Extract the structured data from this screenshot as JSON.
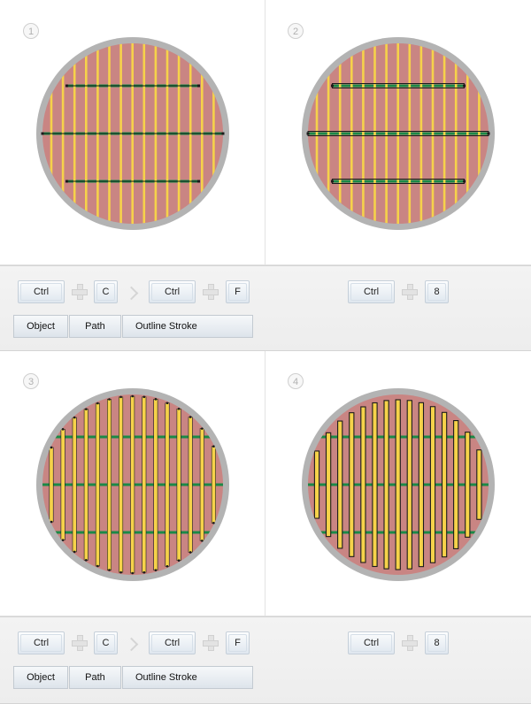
{
  "steps": [
    {
      "number": "1"
    },
    {
      "number": "2"
    },
    {
      "number": "3"
    },
    {
      "number": "4"
    }
  ],
  "shortcuts_a": {
    "key_ctrl": "Ctrl",
    "key_c": "C",
    "key_ctrl_2": "Ctrl",
    "key_f": "F"
  },
  "shortcuts_b": {
    "key_ctrl": "Ctrl",
    "key_8": "8"
  },
  "menu_path": {
    "object": "Object",
    "path": "Path",
    "outline_stroke": "Outline Stroke"
  },
  "colors": {
    "rim": "#b3b3b3",
    "fill": "#c98583",
    "stripe": "#f6d24a",
    "band": "#1a8a47",
    "outline": "#1b1b1b"
  }
}
